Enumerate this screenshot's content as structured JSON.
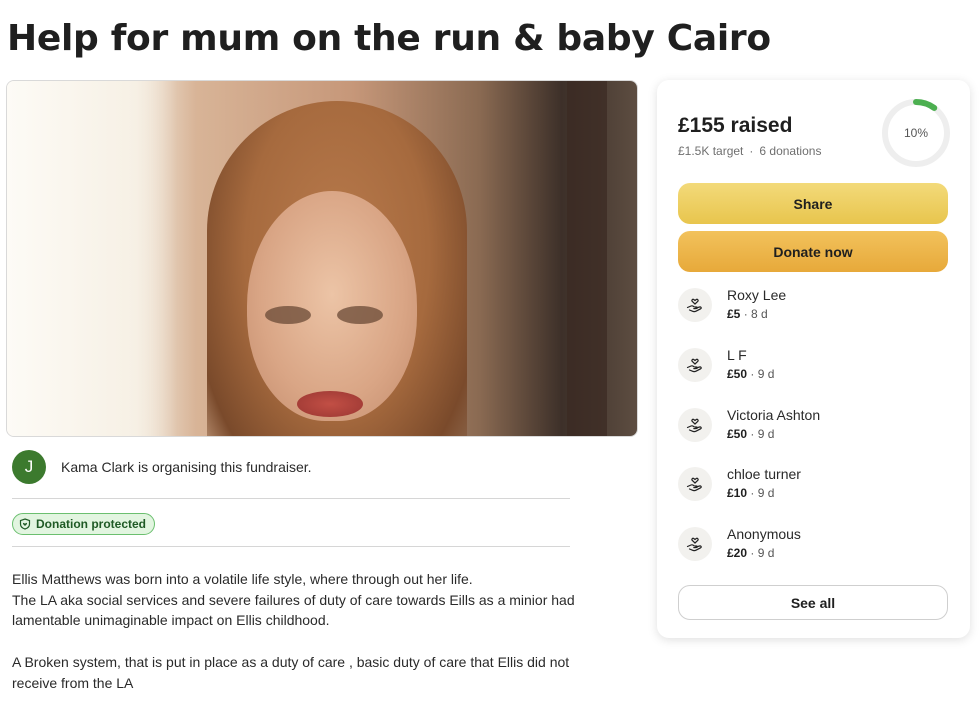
{
  "page": {
    "title": "Help for mum on the run & baby Cairo"
  },
  "organiser": {
    "initial": "J",
    "text": "Kama Clark is organising this fundraiser."
  },
  "badge": {
    "label": "Donation protected"
  },
  "story": {
    "paragraphs": [
      "Ellis Matthews was born into a volatile life style, where through out her life.\nThe LA aka social services and severe failures of duty of care towards Eills as a minior had lamentable unimaginable impact on Ellis childhood.",
      "A Broken system, that is put in place as a duty of care , basic duty of care that Ellis did not receive from the LA"
    ]
  },
  "sidebar": {
    "raised": "£155 raised",
    "target": "£1.5K target",
    "separator": "·",
    "donations_count": "6 donations",
    "progress_percent": 10,
    "progress_label": "10%",
    "share_label": "Share",
    "donate_label": "Donate now",
    "see_all_label": "See all",
    "donations": [
      {
        "name": "Roxy Lee",
        "amount": "£5",
        "time": "· 8 d"
      },
      {
        "name": "L F",
        "amount": "£50",
        "time": "· 9 d"
      },
      {
        "name": "Victoria Ashton",
        "amount": "£50",
        "time": "· 9 d"
      },
      {
        "name": "chloe turner",
        "amount": "£10",
        "time": "· 9 d"
      },
      {
        "name": "Anonymous",
        "amount": "£20",
        "time": "· 9 d"
      }
    ]
  },
  "colors": {
    "progress": "#4caf50",
    "ring_track": "#eeeeee",
    "avatar": "#3c7a2e"
  },
  "icons": {
    "badge": "shield-heart-icon",
    "donation": "heart-hand-icon"
  }
}
